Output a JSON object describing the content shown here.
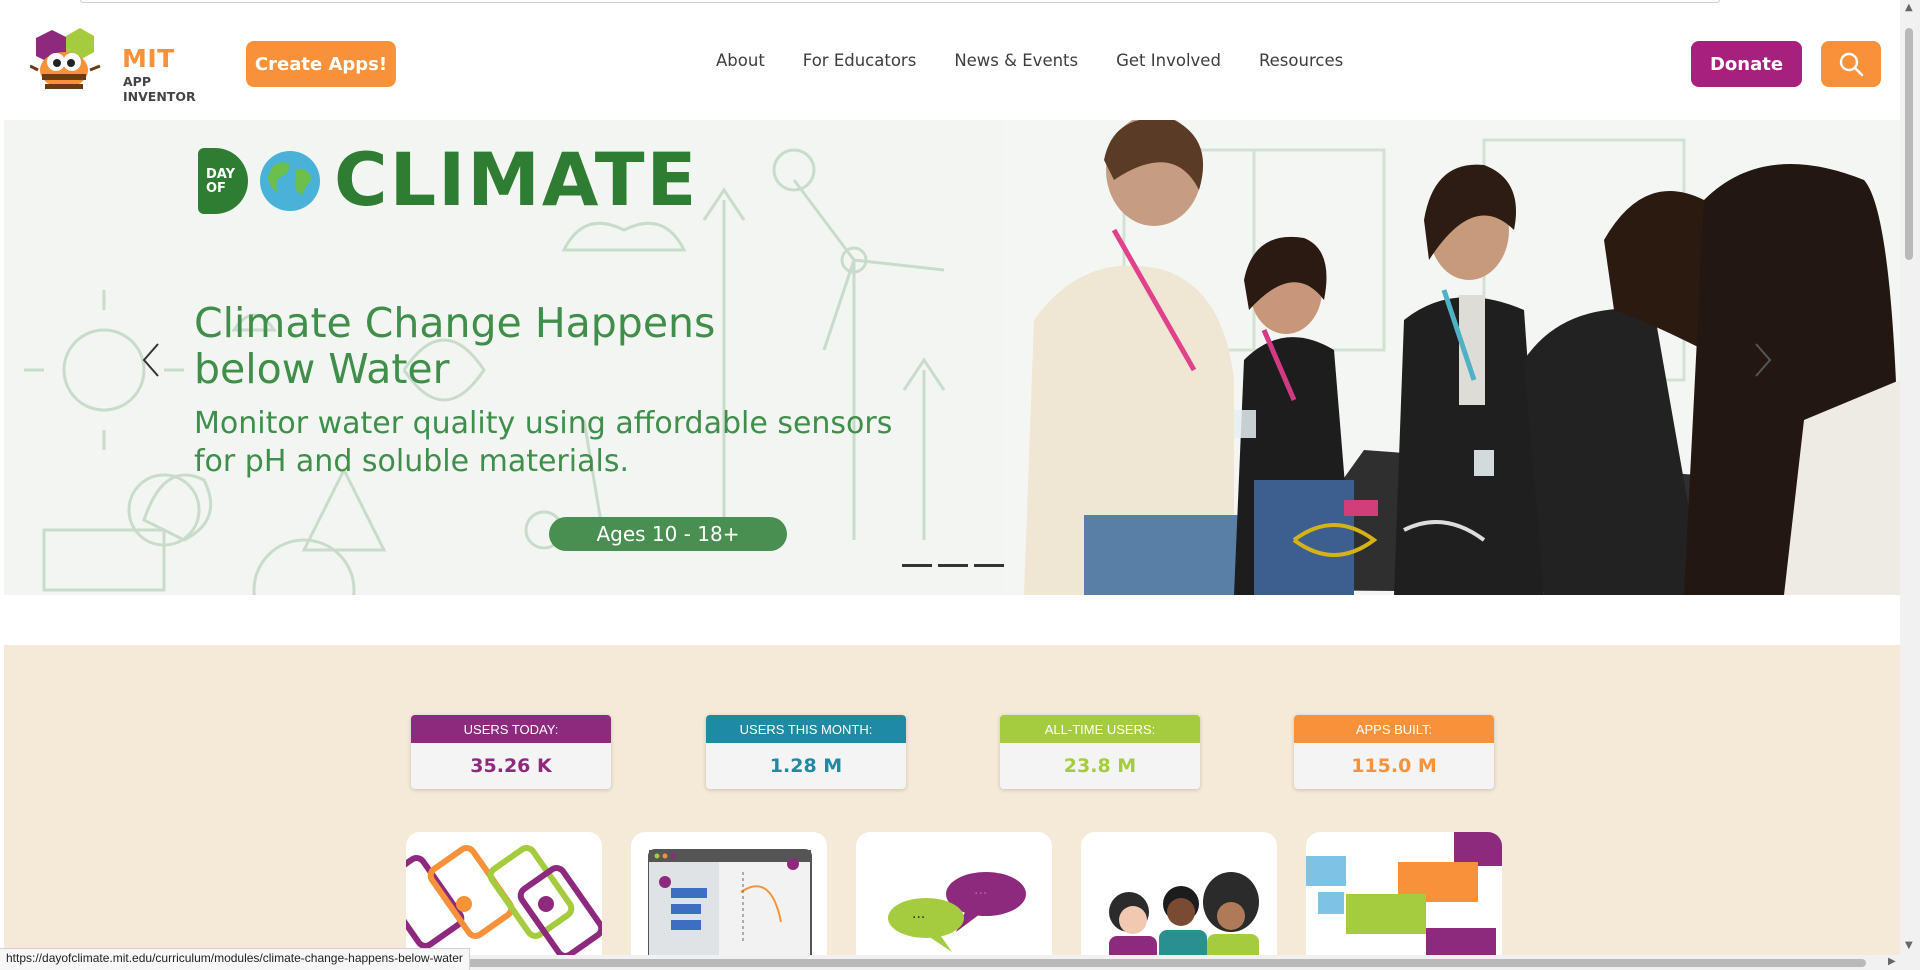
{
  "header": {
    "logo_main": "MIT",
    "logo_sub": "APP INVENTOR",
    "create_label": "Create Apps!",
    "nav": [
      "About",
      "For Educators",
      "News & Events",
      "Get Involved",
      "Resources"
    ],
    "donate_label": "Donate"
  },
  "hero": {
    "logo_dayof": "DAY OF",
    "logo_word": "CLIMATE",
    "title": "Climate Change Happens below Water",
    "subtitle": "Monitor water quality using affordable sensors for pH and soluble materials.",
    "badge": "Ages 10 - 18+",
    "slides": 3,
    "brand_color": "#2e7d32"
  },
  "stats": [
    {
      "label": "USERS TODAY:",
      "value": "35.26 K",
      "color": "#8e2a7e"
    },
    {
      "label": "USERS THIS MONTH:",
      "value": "1.28 M",
      "color": "#1f8aa3"
    },
    {
      "label": "ALL-TIME USERS:",
      "value": "23.8 M",
      "color": "#a4cc3e"
    },
    {
      "label": "APPS BUILT:",
      "value": "115.0 M",
      "color": "#f7923a"
    }
  ],
  "cards": [
    "phones-illustration",
    "blocks-editor-illustration",
    "chat-bubbles-illustration",
    "people-illustration",
    "puzzle-blocks-illustration"
  ],
  "status_url": "https://dayofclimate.mit.edu/curriculum/modules/climate-change-happens-below-water"
}
